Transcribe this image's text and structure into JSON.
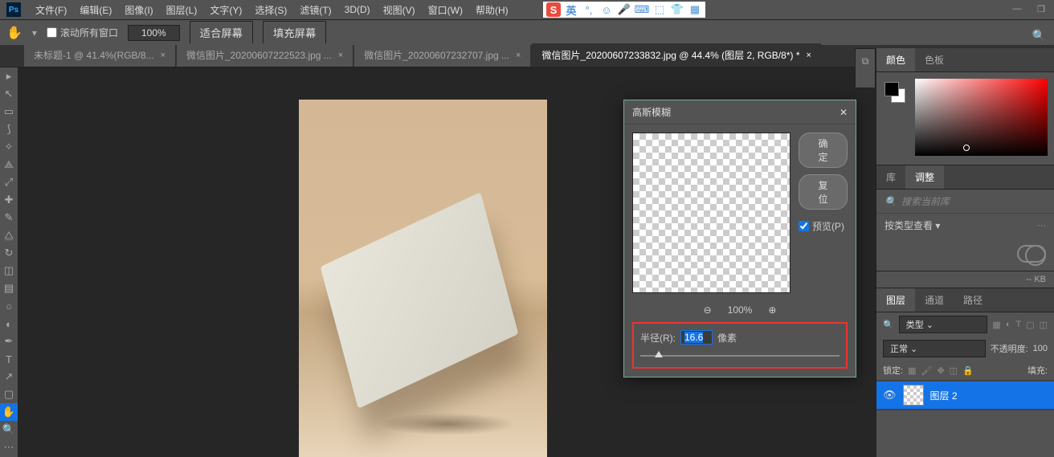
{
  "menu": [
    "文件(F)",
    "编辑(E)",
    "图像(I)",
    "图层(L)",
    "文字(Y)",
    "选择(S)",
    "滤镜(T)",
    "3D(D)",
    "视图(V)",
    "窗口(W)",
    "帮助(H)"
  ],
  "ime": {
    "label": "英"
  },
  "options": {
    "scroll_all": "滚动所有窗口",
    "zoom": "100%",
    "fit": "适合屏幕",
    "fill": "填充屏幕"
  },
  "tabs": [
    {
      "label": "未标题-1 @ 41.4%(RGB/8...",
      "active": false
    },
    {
      "label": "微信图片_20200607222523.jpg ...",
      "active": false
    },
    {
      "label": "微信图片_20200607232707.jpg ...",
      "active": false
    },
    {
      "label": "微信图片_20200607233832.jpg @ 44.4% (图层 2, RGB/8*) *",
      "active": true
    }
  ],
  "dialog": {
    "title": "高斯模糊",
    "ok": "确定",
    "reset": "复位",
    "preview": "预览(P)",
    "zoom": "100%",
    "radius_label": "半径(R):",
    "radius_value": "16.6",
    "unit": "像素"
  },
  "panels": {
    "color_tab": "颜色",
    "swatch_tab": "色板",
    "lib_tab": "库",
    "adjust_tab": "调整",
    "search_ph": "搜索当前库",
    "view_label": "按类型查看",
    "kb": "-- KB",
    "layers_tab": "图层",
    "channels_tab": "通道",
    "paths_tab": "路径",
    "kind": "类型",
    "blend": "正常",
    "opacity_l": "不透明度:",
    "opacity_v": "100",
    "lock_l": "锁定:",
    "fill_l": "填充:",
    "layer_name": "图层 2"
  }
}
